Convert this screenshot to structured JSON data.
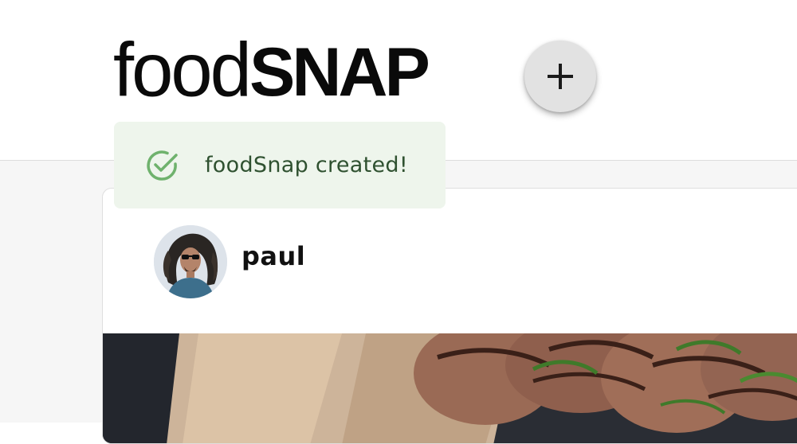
{
  "app": {
    "logo_light": "food",
    "logo_bold": "SNAP"
  },
  "header": {
    "add_button_icon": "plus-icon"
  },
  "toast": {
    "icon": "check-circle-icon",
    "message": "foodSnap created!",
    "accent_color": "#6fb26d",
    "background_color": "#eef5ec"
  },
  "post": {
    "username": "paul",
    "avatar_icon": "user-avatar",
    "image_icon": "food-photo"
  }
}
